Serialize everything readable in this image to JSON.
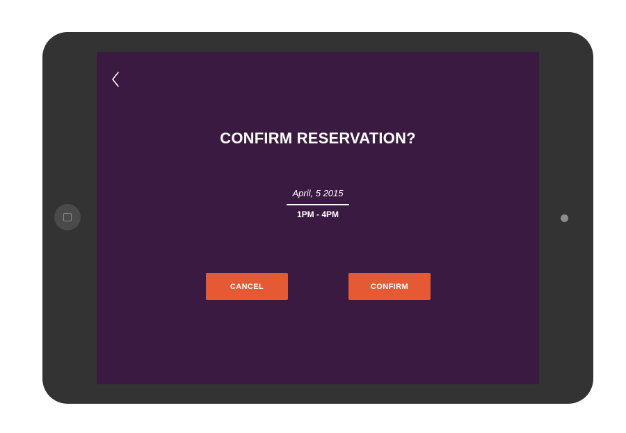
{
  "screen": {
    "back_icon": "chevron-left-icon",
    "title": "CONFIRM RESERVATION?",
    "reservation": {
      "date": "April, 5 2015",
      "time": "1PM - 4PM"
    },
    "buttons": {
      "cancel_label": "CANCEL",
      "confirm_label": "CONFIRM"
    }
  },
  "colors": {
    "screen_background": "#3b1a41",
    "device_frame": "#333333",
    "button_accent": "#e55a34",
    "text": "#ffffff"
  }
}
